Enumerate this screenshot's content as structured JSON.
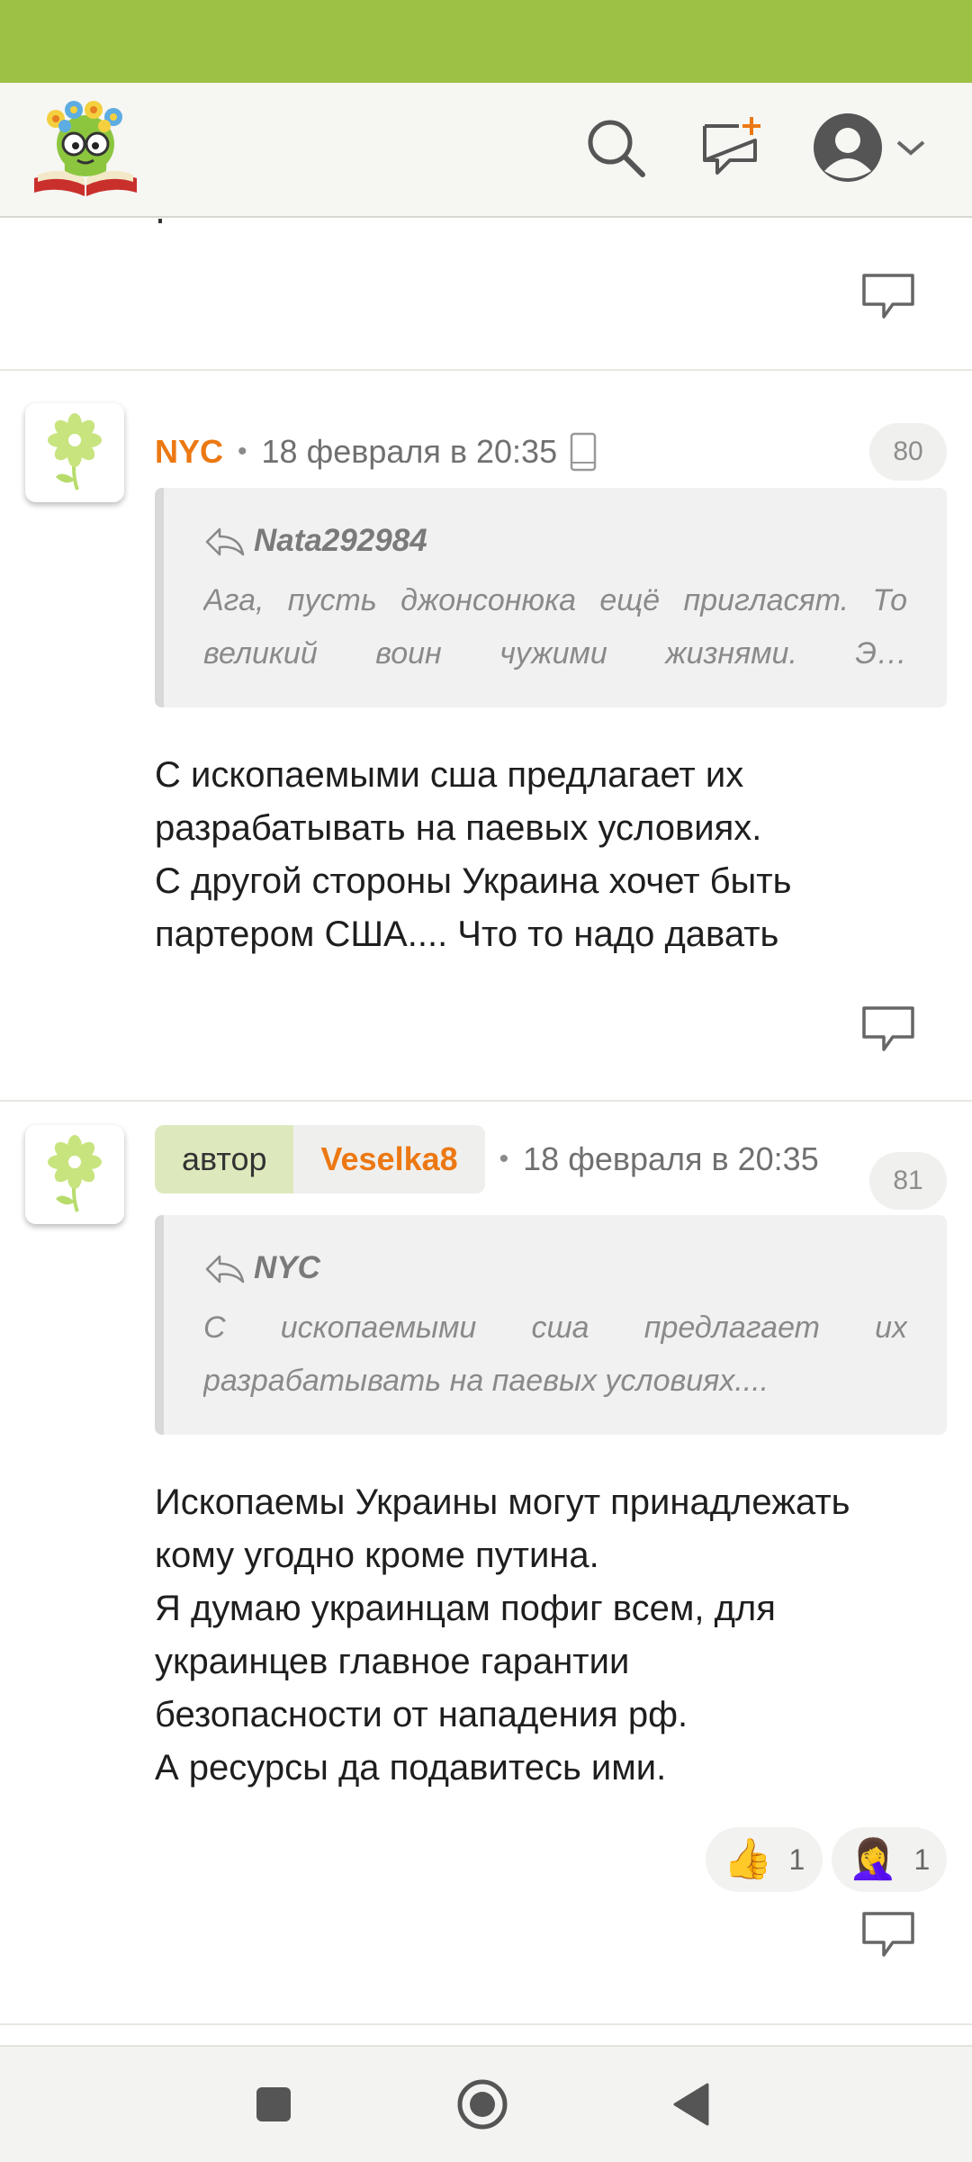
{
  "header": {
    "logo_icon": "bookworm-logo-icon",
    "search_icon": "search-icon",
    "new_post_icon": "new-message-icon",
    "profile_icon": "user-avatar-icon",
    "menu_icon": "chevron-down-icon"
  },
  "comments": [
    {
      "author": "NYC",
      "separator": "•",
      "date": "18 февраля в 20:35",
      "device_icon": "phone-icon",
      "number": "80",
      "quote": {
        "author": "Nata292984",
        "lines": [
          "Ага, пусть джонсонюка ещё пригласят. То",
          "великий воин чужими жизнями. Э…"
        ]
      },
      "text_lines": [
        "С ископаемыми сша предлагает их",
        "разрабатывать на паевых условиях.",
        "С другой стороны Украина хочет быть",
        "партером США.... Что то надо давать"
      ]
    },
    {
      "role_badge": "автор",
      "author": "Veselka8",
      "separator": "•",
      "date": "18 февраля в 20:35",
      "number": "81",
      "quote": {
        "author": "NYC",
        "lines": [
          "С ископаемыми сша предлагает их",
          "разрабатывать на паевых условиях...."
        ]
      },
      "text_lines": [
        "Ископаемы Украины могут принадлежать",
        "кому угодно кроме путина.",
        "Я думаю украинцам пофиг всем, для",
        "украинцев главное гарантии",
        "безопасности от нападения рф.",
        "А ресурсы да подавитесь ими."
      ],
      "reactions": [
        {
          "emoji": "👍",
          "count": "1"
        },
        {
          "emoji": "🤦‍♀️",
          "count": "1"
        }
      ]
    }
  ],
  "colors": {
    "status_bar": "#9dc145",
    "author": "#ec7813",
    "role_badge_bg": "#dde9bd"
  },
  "navbar": {
    "recents_icon": "square-icon",
    "home_icon": "circle-home-icon",
    "back_icon": "triangle-back-icon"
  }
}
